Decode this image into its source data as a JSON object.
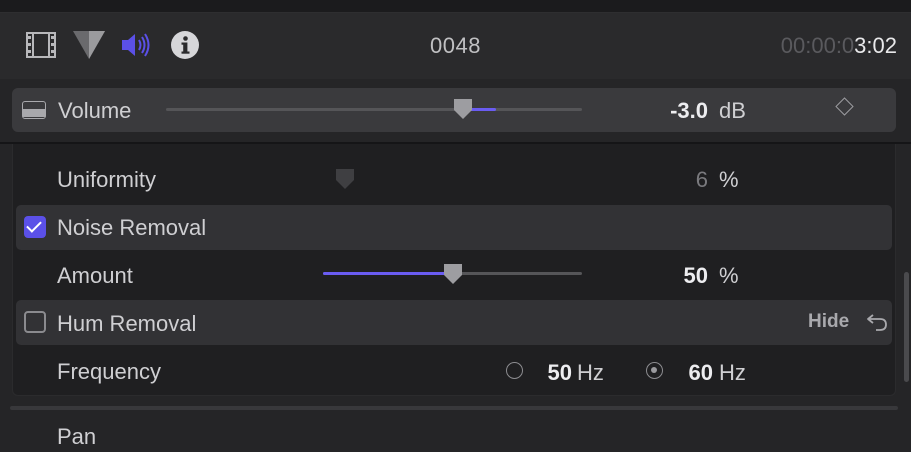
{
  "header": {
    "icons": [
      "video-inspector-icon",
      "color-inspector-icon",
      "audio-inspector-icon",
      "info-inspector-icon"
    ],
    "clip_name": "0048",
    "timecode_dim": "00:00:0",
    "timecode_bright": "3:02"
  },
  "volume": {
    "label": "Volume",
    "value": "-3.0",
    "unit": "dB",
    "level_fraction": 0.72
  },
  "uniformity": {
    "label": "Uniformity",
    "value": "6",
    "unit": "%"
  },
  "noise_removal": {
    "label": "Noise Removal",
    "checked": true
  },
  "amount": {
    "label": "Amount",
    "value": "50",
    "unit": "%",
    "level_fraction": 0.5
  },
  "hum_removal": {
    "label": "Hum Removal",
    "checked": false,
    "hide_label": "Hide"
  },
  "frequency": {
    "label": "Frequency",
    "options": [
      {
        "value": "50",
        "unit": "Hz",
        "selected": false
      },
      {
        "value": "60",
        "unit": "Hz",
        "selected": true
      }
    ]
  },
  "pan": {
    "label": "Pan"
  },
  "colors": {
    "accent": "#5b50e8",
    "background": "#252527"
  }
}
